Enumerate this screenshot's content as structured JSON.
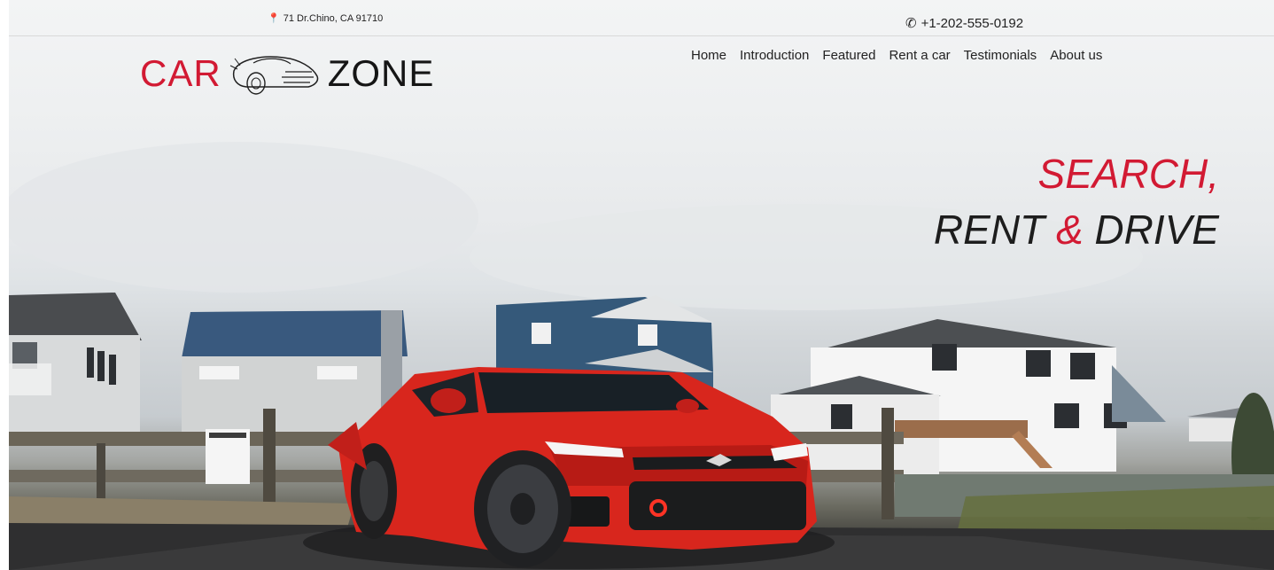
{
  "topbar": {
    "address": "71 Dr.Chino, CA 91710",
    "phone": "+1-202-555-0192"
  },
  "brand": {
    "word1": "CAR",
    "word2": "ZONE"
  },
  "nav": {
    "items": [
      "Home",
      "Introduction",
      "Featured",
      "Rent a car",
      "Testimonials",
      "About us"
    ]
  },
  "hero": {
    "line1": "SEARCH,",
    "line2_part1": "RENT",
    "line2_amp": "&",
    "line2_part2": "DRIVE",
    "image_alt": "Red sports car parked in front of houses"
  },
  "colors": {
    "accent": "#d21a33",
    "text": "#222222"
  },
  "icons": {
    "address": "map-pin-icon",
    "phone": "phone-icon"
  }
}
